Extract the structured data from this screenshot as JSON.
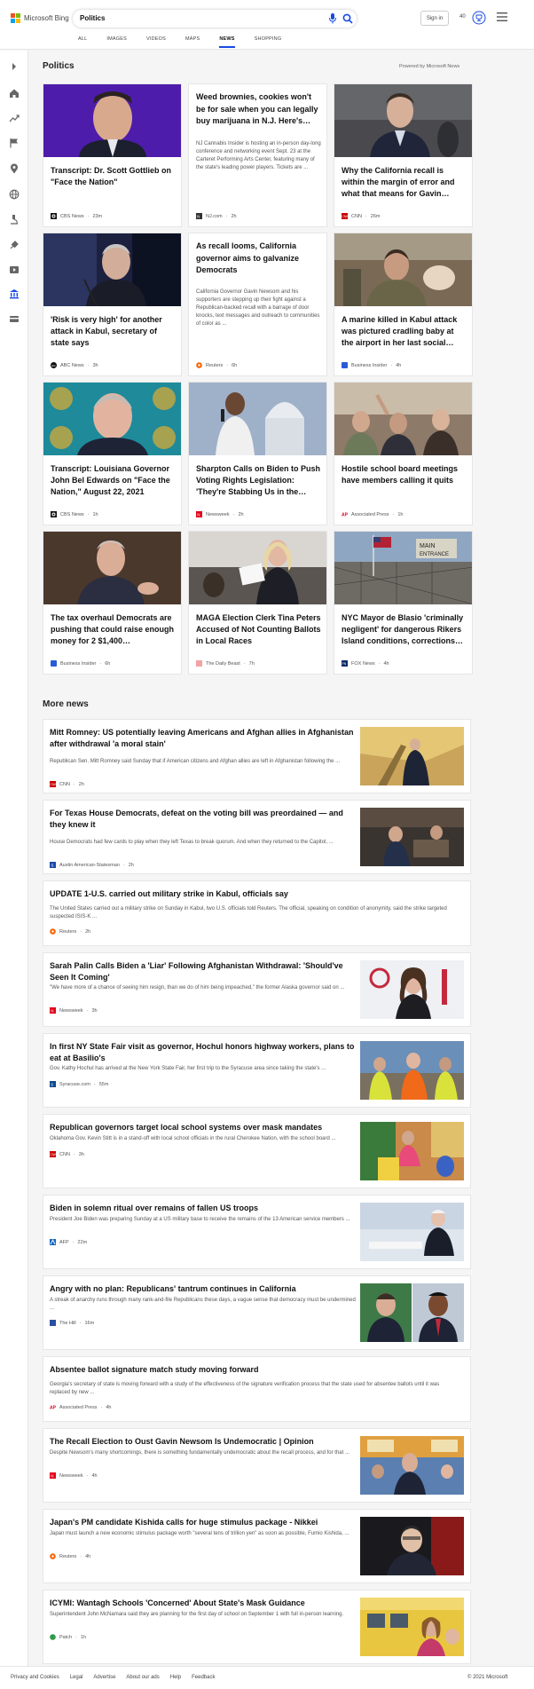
{
  "header": {
    "logo_text": "Microsoft Bing",
    "search_value": "Politics",
    "signin_label": "Sign in",
    "points": "40",
    "tabs": [
      {
        "label": "ALL"
      },
      {
        "label": "IMAGES"
      },
      {
        "label": "VIDEOS"
      },
      {
        "label": "MAPS"
      },
      {
        "label": "NEWS"
      },
      {
        "label": "SHOPPING"
      }
    ],
    "active_tab": "NEWS"
  },
  "main": {
    "section_title": "Politics",
    "powered_by": "Powered by Microsoft News",
    "cards": [
      {
        "title": "Transcript: Dr. Scott Gottlieb on \"Face the Nation\"",
        "source": "CBS News",
        "time": "23m",
        "has_image": true
      },
      {
        "title": "Weed brownies, cookies won't be for sale when you can legally buy marijuana in N.J. Here's…",
        "summary": "NJ Cannabis Insider is hosting an in-person day-long conference and networking event Sept. 23 at the Carteret Performing Arts Center, featuring many of the state's leading power players. Tickets are ...",
        "source": "NJ.com",
        "time": "2h",
        "has_image": false
      },
      {
        "title": "Why the California recall is within the margin of error and what that means for Gavin…",
        "source": "CNN",
        "time": "26m",
        "has_image": true
      },
      {
        "title": "'Risk is very high' for another attack in Kabul, secretary of state says",
        "source": "ABC News",
        "time": "3h",
        "has_image": true
      },
      {
        "title": "As recall looms, California governor aims to galvanize Democrats",
        "summary": "California Governor Gavin Newsom and his supporters are stepping up their fight against a Republican-backed recall with a barrage of door knocks, text messages and outreach to communities of color as ...",
        "source": "Reuters",
        "time": "6h",
        "has_image": false
      },
      {
        "title": "A marine killed in Kabul attack was pictured cradling baby at the airport in her last social…",
        "source": "Business Insider",
        "time": "4h",
        "has_image": true
      },
      {
        "title": "Transcript: Louisiana Governor John Bel Edwards on \"Face the Nation,\" August 22, 2021",
        "source": "CBS News",
        "time": "1h",
        "has_image": true
      },
      {
        "title": "Sharpton Calls on Biden to Push Voting Rights Legislation: 'They're Stabbing Us in the…",
        "source": "Newsweek",
        "time": "2h",
        "has_image": true
      },
      {
        "title": "Hostile school board meetings have members calling it quits",
        "source": "Associated Press",
        "time": "1h",
        "has_image": true
      },
      {
        "title": "The tax overhaul Democrats are pushing that could raise enough money for 2 $1,400…",
        "source": "Business Insider",
        "time": "6h",
        "has_image": true
      },
      {
        "title": "MAGA Election Clerk Tina Peters Accused of Not Counting Ballots in Local Races",
        "source": "The Daily Beast",
        "time": "7h",
        "has_image": true
      },
      {
        "title": "NYC Mayor de Blasio 'criminally negligent' for dangerous Rikers Island conditions, corrections…",
        "source": "FOX News",
        "time": "4h",
        "has_image": true
      }
    ],
    "more_news_title": "More news",
    "more_news": [
      {
        "title": "Mitt Romney: US potentially leaving Americans and Afghan allies in Afghanistan after withdrawal 'a moral stain'",
        "summary": "Republican Sen. Mitt Romney said Sunday that if American citizens and Afghan allies are left in Afghanistan following the ...",
        "source": "CNN",
        "time": "2h",
        "has_thumb": true
      },
      {
        "title": "For Texas House Democrats, defeat on the voting bill was preordained — and they knew it",
        "summary": "House Democrats had few cards to play when they left Texas to break quorum. And when they returned to the Capitol, ...",
        "source": "Austin American-Statesman",
        "time": "2h",
        "has_thumb": true
      },
      {
        "title": "UPDATE 1-U.S. carried out military strike in Kabul, officials say",
        "summary": "The United States carried out a military strike on Sunday in Kabul, two U.S. officials told Reuters. The official, speaking on condition of anonymity, said the strike targeted suspected ISIS-K ...",
        "source": "Reuters",
        "time": "2h",
        "has_thumb": false
      },
      {
        "title": "Sarah Palin Calls Biden a 'Liar' Following Afghanistan Withdrawal: 'Should've Seen It Coming'",
        "summary": "\"We have more of a chance of seeing him resign, than we do of him being impeached,\" the former Alaska governor said on ...",
        "source": "Newsweek",
        "time": "3h",
        "has_thumb": true
      },
      {
        "title": "In first NY State Fair visit as governor, Hochul honors highway workers, plans to eat at Basilio's",
        "summary": "Gov. Kathy Hochul has arrived at the New York State Fair, her first trip to the Syracuse area since taking the state's ...",
        "source": "Syracuse.com",
        "time": "55m",
        "has_thumb": true
      },
      {
        "title": "Republican governors target local school systems over mask mandates",
        "summary": "Oklahoma Gov. Kevin Stitt is in a stand-off with local school officials in the rural Cherokee Nation, with the school board ...",
        "source": "CNN",
        "time": "3h",
        "has_thumb": true
      },
      {
        "title": "Biden in solemn ritual over remains of fallen US troops",
        "summary": "President Joe Biden was preparing Sunday at a US military base to receive the remains of the 13 American service members ...",
        "source": "AFP",
        "time": "22m",
        "has_thumb": true
      },
      {
        "title": "Angry with no plan: Republicans' tantrum continues in California",
        "summary": "A streak of anarchy runs through many rank-and-file Republicans these days, a vague sense that democracy must be undermined ...",
        "source": "The Hill",
        "time": "16m",
        "has_thumb": true
      },
      {
        "title": "Absentee ballot signature match study moving forward",
        "summary": "Georgia's secretary of state is moving forward with a study of the effectiveness of the signature verification process that the state used for absentee ballots until it was replaced by new ...",
        "source": "Associated Press",
        "time": "4h",
        "has_thumb": false
      },
      {
        "title": "The Recall Election to Oust Gavin Newsom Is Undemocratic | Opinion",
        "summary": "Despite Newsom's many shortcomings, there is something fundamentally undemocratic about the recall process, and for that ...",
        "source": "Newsweek",
        "time": "4h",
        "has_thumb": true
      },
      {
        "title": "Japan's PM candidate Kishida calls for huge stimulus package - Nikkei",
        "summary": "Japan must launch a new economic stimulus package worth \"several tens of trillion yen\" as soon as possible, Fumio Kishida, ...",
        "source": "Reuters",
        "time": "4h",
        "has_thumb": true
      },
      {
        "title": "ICYMI: Wantagh Schools 'Concerned' About State's Mask Guidance",
        "summary": "Superintendent John McNamara said they are planning for the first day of school on September 1 with full in-person learning.",
        "source": "Patch",
        "time": "1h",
        "has_thumb": true
      }
    ]
  },
  "footer": {
    "links": [
      "Privacy and Cookies",
      "Legal",
      "Advertise",
      "About our ads",
      "Help",
      "Feedback"
    ],
    "copyright": "© 2021 Microsoft"
  }
}
